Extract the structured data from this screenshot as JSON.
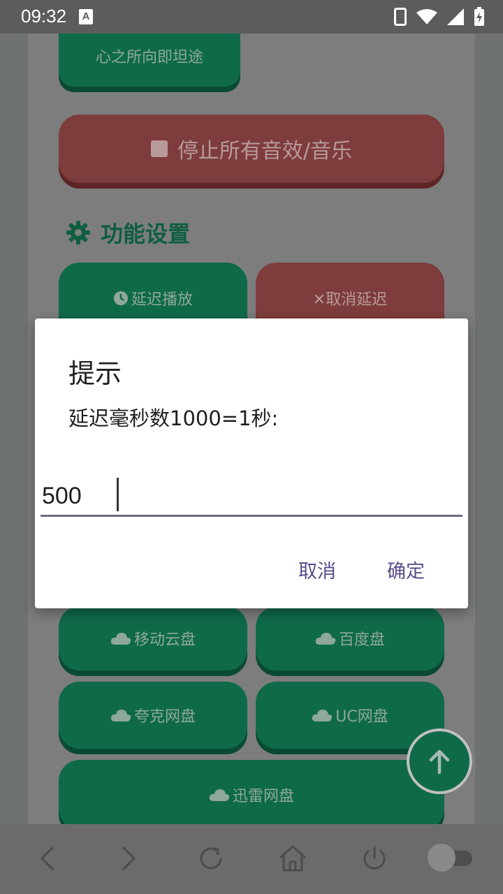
{
  "status_bar": {
    "time": "09:32",
    "a_badge": "A"
  },
  "page": {
    "top_button": "心之所向即坦途",
    "stop_button": "停止所有音效/音乐",
    "section_title": "功能设置",
    "delay_play": "延迟播放",
    "cancel_delay": "✕取消延迟",
    "cloud_buttons": [
      "移动云盘",
      "百度盘",
      "夸克网盘",
      "UC网盘",
      "迅雷网盘"
    ]
  },
  "dialog": {
    "title": "提示",
    "message": "延迟毫秒数1000=1秒:",
    "input_value": "500",
    "cancel_label": "取消",
    "ok_label": "确定"
  },
  "colors": {
    "accent_green": "#0f6a48",
    "danger_red": "#7e3c3c",
    "dialog_button": "#5a4b8a"
  },
  "icons": [
    "wifi-icon",
    "signal-icon",
    "battery-icon",
    "phone-icon",
    "gear-icon",
    "clock-icon",
    "cloud-icon",
    "arrow-up-icon",
    "back-icon",
    "forward-icon",
    "refresh-icon",
    "home-icon",
    "power-icon"
  ]
}
